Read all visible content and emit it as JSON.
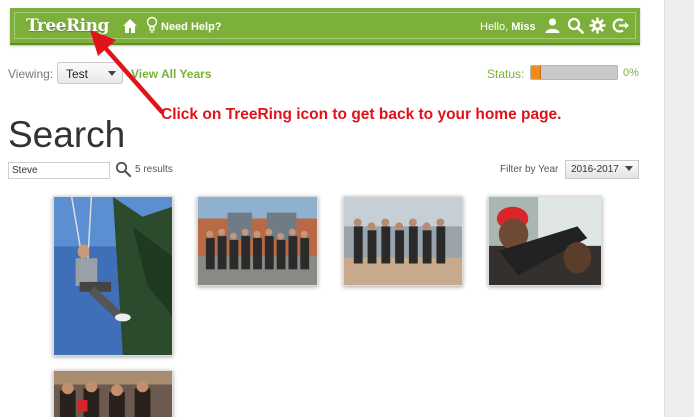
{
  "header": {
    "logo": "TreeRing",
    "help": "Need Help?",
    "greeting_prefix": "Hello,",
    "greeting_name": "Miss"
  },
  "viewing": {
    "label": "Viewing:",
    "selected": "Test",
    "view_all": "View All Years"
  },
  "status": {
    "label": "Status:",
    "percent_text": "0%",
    "progress_fraction": 0.12,
    "fill_color": "#f08b1d"
  },
  "annotation": {
    "text": "Click on TreeRing icon to get back to your home page.",
    "color": "#e0131a"
  },
  "page_title": "Search",
  "search": {
    "value": "Steve",
    "results": "5 results"
  },
  "filter": {
    "label": "Filter by Year",
    "selected": "2016-2017"
  },
  "photos": [
    "photo-1-zipline",
    "photo-2-group-building",
    "photo-3-group-plaza",
    "photo-4-person-red-hat",
    "photo-5-group-indoor"
  ],
  "colors": {
    "brand_green": "#7db03a",
    "annotation_red": "#e0131a"
  }
}
